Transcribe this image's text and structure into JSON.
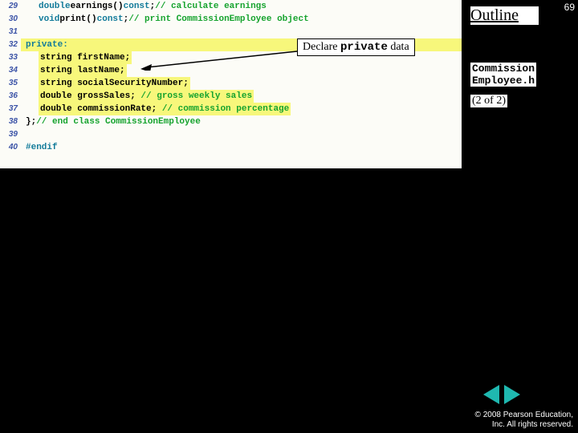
{
  "page_number": "69",
  "outline_label": "Outline",
  "callout": {
    "prefix": "Declare ",
    "keyword": "private",
    "suffix": " data"
  },
  "file_label_line1": "Commission",
  "file_label_line2": "Employee.h",
  "page_of": "(2 of 2)",
  "code": {
    "l29": {
      "n": "29",
      "kw": "double",
      "txt": " earnings() ",
      "k2": "const",
      "txt2": "; ",
      "cm": "// calculate earnings"
    },
    "l30": {
      "n": "30",
      "kw": "void",
      "txt": " print() ",
      "k2": "const",
      "txt2": "; ",
      "cm": "// print CommissionEmployee object"
    },
    "l31": {
      "n": "31"
    },
    "l32": {
      "n": "32",
      "txt": "private:"
    },
    "l33": {
      "n": "33",
      "txt": "string firstName;"
    },
    "l34": {
      "n": "34",
      "txt": "string lastName;"
    },
    "l35": {
      "n": "35",
      "txt": "string socialSecurityNumber;"
    },
    "l36": {
      "n": "36",
      "txt": "double grossSales; ",
      "cm": "// gross weekly sales"
    },
    "l37": {
      "n": "37",
      "txt": "double commissionRate; ",
      "cm": "// commission percentage"
    },
    "l38": {
      "n": "38",
      "txt": "}; ",
      "cm": "// end class CommissionEmployee"
    },
    "l39": {
      "n": "39"
    },
    "l40": {
      "n": "40",
      "txt": "#endif"
    }
  },
  "copyright_line1": "© 2008 Pearson Education,",
  "copyright_line2": "Inc.  All rights reserved."
}
